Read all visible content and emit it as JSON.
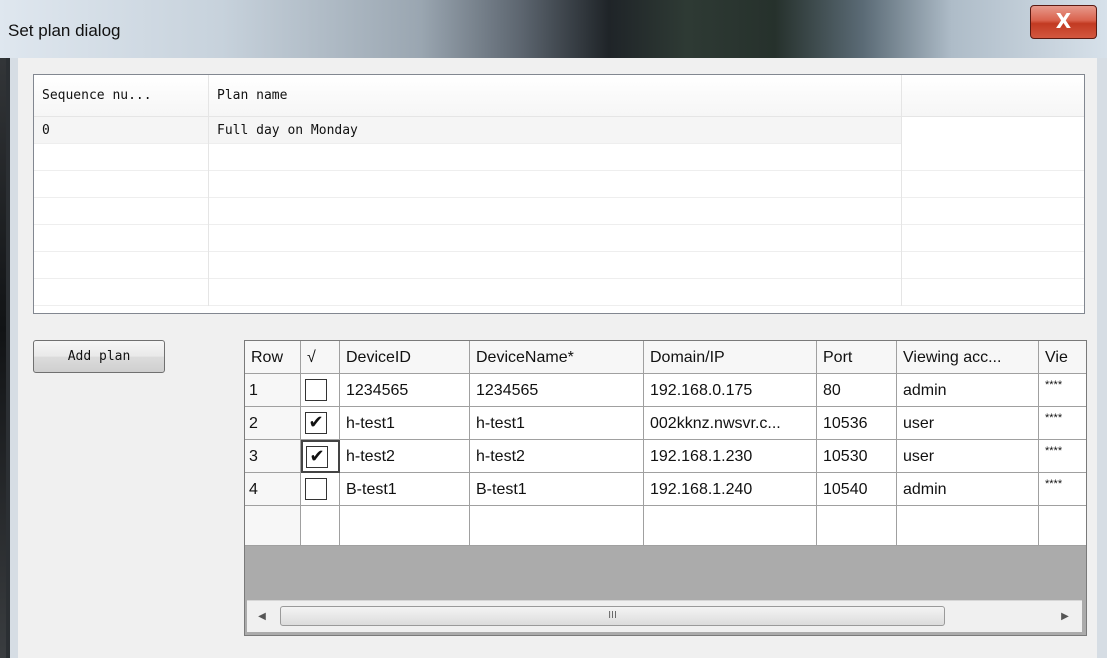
{
  "window": {
    "title": "Set plan dialog",
    "close_label": "X"
  },
  "plan_list": {
    "columns": [
      "Sequence nu...",
      "Plan name",
      ""
    ],
    "rows": [
      {
        "seq": "0",
        "name": "Full day on Monday"
      }
    ]
  },
  "buttons": {
    "add_plan": "Add plan"
  },
  "device_grid": {
    "columns": [
      "Row",
      "√",
      "DeviceID",
      "DeviceName*",
      "Domain/IP",
      "Port",
      "Viewing acc...",
      "Vie"
    ],
    "rows": [
      {
        "row": "1",
        "checked": false,
        "device_id": "1234565",
        "device_name": "1234565",
        "domain": "192.168.0.175",
        "port": "80",
        "account": "admin",
        "password": "****"
      },
      {
        "row": "2",
        "checked": true,
        "device_id": "h-test1",
        "device_name": "h-test1",
        "domain": "002kknz.nwsvr.c...",
        "port": "10536",
        "account": "user",
        "password": "****"
      },
      {
        "row": "3",
        "checked": true,
        "device_id": "h-test2",
        "device_name": "h-test2",
        "domain": "192.168.1.230",
        "port": "10530",
        "account": "user",
        "password": "****"
      },
      {
        "row": "4",
        "checked": false,
        "device_id": "B-test1",
        "device_name": "B-test1",
        "domain": "192.168.1.240",
        "port": "10540",
        "account": "admin",
        "password": "****"
      }
    ],
    "check_glyph": "✔"
  },
  "scrollbar": {
    "left_arrow": "◀",
    "right_arrow": "▶",
    "grip": "III"
  }
}
